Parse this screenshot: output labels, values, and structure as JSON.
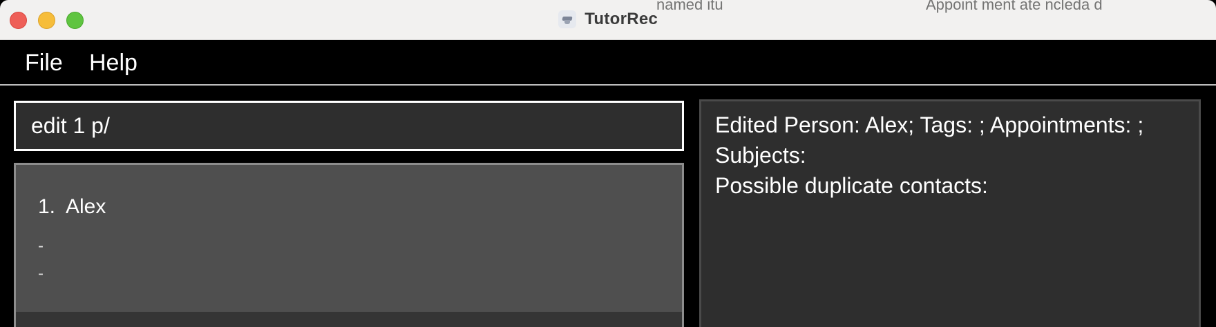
{
  "window": {
    "title": "TutorRec",
    "background_overlap_text": [
      "named  itu",
      "Appoint  ment  ate  ncleda  d"
    ]
  },
  "menubar": {
    "items": [
      {
        "label": "File"
      },
      {
        "label": "Help"
      }
    ]
  },
  "command_box": {
    "value": "edit 1 p/"
  },
  "person_list": {
    "items": [
      {
        "index": "1.",
        "name": "Alex",
        "lines": [
          "-",
          "-"
        ]
      }
    ]
  },
  "result_display": {
    "lines": [
      "Edited Person: Alex; Tags: ; Appointments: ;",
      "Subjects:",
      "Possible duplicate contacts:"
    ]
  },
  "colors": {
    "background": "#000000",
    "titlebar": "#f2f1f0",
    "panel": "#2e2e2e",
    "card": "#4f4f4f",
    "close": "#ee5f58",
    "minimize": "#f6bd3a",
    "maximize": "#5fc440"
  }
}
